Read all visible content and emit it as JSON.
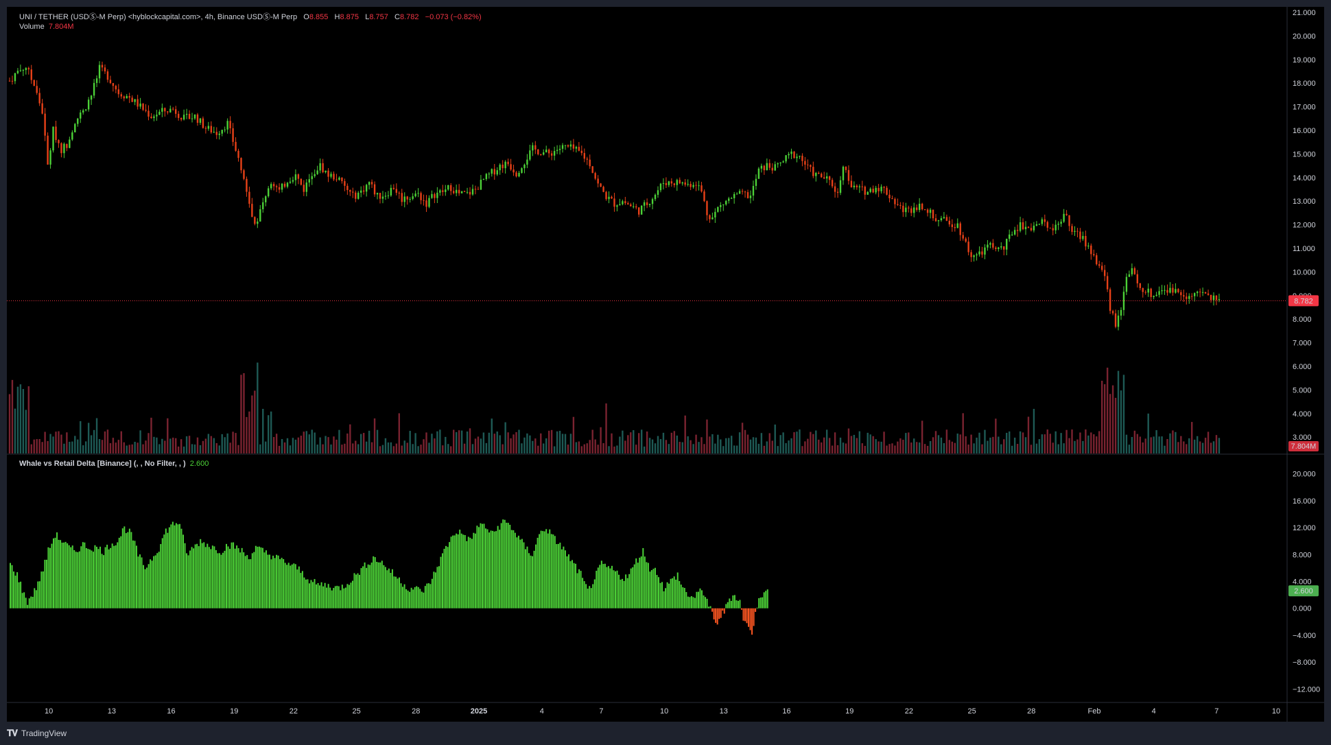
{
  "header": {
    "symbol": "UNI / TETHER (USDⓈ-M Perp) <hyblockcapital.com>, 4h, Binance USDⓈ-M Perp",
    "o_label": "O",
    "o_value": "8.855",
    "h_label": "H",
    "h_value": "8.875",
    "l_label": "L",
    "l_value": "8.757",
    "c_label": "C",
    "c_value": "8.782",
    "change": "−0.073 (−0.82%)",
    "volume_label": "Volume",
    "volume_value": "7.804M"
  },
  "indicator": {
    "title": "Whale vs Retail Delta [Binance] (, , No Filter, , )",
    "value": "2.600"
  },
  "footer": {
    "brand": "TradingView"
  },
  "colors": {
    "up": "#22ab94",
    "down": "#f23645",
    "candle_up": "#4cd137",
    "candle_down": "#e84118",
    "vol_up": "#1e5a55",
    "vol_down": "#7a2330",
    "delta_pos": "#4cd137",
    "delta_neg": "#ff5722",
    "price_tag": "#f23645",
    "delta_tag": "#4caf50"
  },
  "chart_data": [
    {
      "type": "candlestick",
      "title": "",
      "price_axis_ticks": [
        "21.000",
        "20.000",
        "19.000",
        "18.000",
        "17.000",
        "16.000",
        "15.000",
        "14.000",
        "13.000",
        "12.000",
        "11.000",
        "10.000",
        "9.000",
        "8.000",
        "7.000",
        "6.000",
        "5.000",
        "4.000",
        "3.000"
      ],
      "ylim": [
        2.5,
        21.0
      ],
      "x_ticks": [
        "10",
        "13",
        "16",
        "19",
        "22",
        "25",
        "28",
        "2025",
        "4",
        "7",
        "10",
        "13",
        "16",
        "19",
        "22",
        "25",
        "28",
        "Feb",
        "4",
        "7",
        "10"
      ],
      "last_price": "8.782",
      "price_path": [
        [
          0,
          18.1
        ],
        [
          3,
          18.5
        ],
        [
          6,
          18.7
        ],
        [
          9,
          17.9
        ],
        [
          12,
          16.8
        ],
        [
          14,
          14.5
        ],
        [
          16,
          16.0
        ],
        [
          19,
          15.2
        ],
        [
          21,
          15.4
        ],
        [
          24,
          16.4
        ],
        [
          27,
          16.8
        ],
        [
          30,
          17.5
        ],
        [
          33,
          18.6
        ],
        [
          36,
          18.3
        ],
        [
          40,
          17.6
        ],
        [
          44,
          17.4
        ],
        [
          48,
          17.0
        ],
        [
          52,
          16.6
        ],
        [
          56,
          16.8
        ],
        [
          60,
          16.9
        ],
        [
          64,
          16.5
        ],
        [
          68,
          16.6
        ],
        [
          72,
          16.1
        ],
        [
          76,
          15.9
        ],
        [
          80,
          16.3
        ],
        [
          84,
          14.8
        ],
        [
          86,
          13.9
        ],
        [
          88,
          12.8
        ],
        [
          90,
          12.0
        ],
        [
          92,
          12.6
        ],
        [
          94,
          13.3
        ],
        [
          96,
          13.9
        ],
        [
          99,
          13.4
        ],
        [
          102,
          13.9
        ],
        [
          105,
          14.1
        ],
        [
          108,
          13.5
        ],
        [
          111,
          14.2
        ],
        [
          114,
          14.5
        ],
        [
          117,
          14.1
        ],
        [
          120,
          14.0
        ],
        [
          123,
          13.6
        ],
        [
          126,
          13.2
        ],
        [
          129,
          13.4
        ],
        [
          132,
          13.8
        ],
        [
          135,
          13.2
        ],
        [
          138,
          13.3
        ],
        [
          141,
          13.6
        ],
        [
          144,
          13.1
        ],
        [
          147,
          13.2
        ],
        [
          150,
          13.3
        ],
        [
          153,
          12.9
        ],
        [
          156,
          13.3
        ],
        [
          159,
          13.4
        ],
        [
          162,
          13.6
        ],
        [
          165,
          13.3
        ],
        [
          168,
          13.3
        ],
        [
          171,
          13.5
        ],
        [
          174,
          13.9
        ],
        [
          177,
          14.2
        ],
        [
          180,
          14.5
        ],
        [
          183,
          14.6
        ],
        [
          186,
          14.2
        ],
        [
          189,
          14.7
        ],
        [
          192,
          15.2
        ],
        [
          195,
          15.1
        ],
        [
          198,
          15.0
        ],
        [
          201,
          15.2
        ],
        [
          204,
          15.3
        ],
        [
          207,
          15.2
        ],
        [
          210,
          15.0
        ],
        [
          213,
          14.6
        ],
        [
          216,
          13.7
        ],
        [
          219,
          13.2
        ],
        [
          222,
          12.9
        ],
        [
          225,
          13.0
        ],
        [
          228,
          12.8
        ],
        [
          231,
          12.6
        ],
        [
          234,
          12.9
        ],
        [
          237,
          13.3
        ],
        [
          240,
          13.8
        ],
        [
          243,
          13.8
        ],
        [
          246,
          13.8
        ],
        [
          249,
          13.7
        ],
        [
          252,
          13.8
        ],
        [
          254,
          13.4
        ],
        [
          256,
          12.5
        ],
        [
          258,
          12.3
        ],
        [
          260,
          12.7
        ],
        [
          263,
          13.0
        ],
        [
          266,
          13.2
        ],
        [
          269,
          13.3
        ],
        [
          272,
          13.2
        ],
        [
          275,
          14.3
        ],
        [
          278,
          14.5
        ],
        [
          281,
          14.4
        ],
        [
          284,
          14.7
        ],
        [
          287,
          15.0
        ],
        [
          290,
          14.9
        ],
        [
          293,
          14.4
        ],
        [
          296,
          14.1
        ],
        [
          299,
          14.0
        ],
        [
          302,
          13.7
        ],
        [
          304,
          13.3
        ],
        [
          306,
          14.6
        ],
        [
          309,
          13.6
        ],
        [
          312,
          13.5
        ],
        [
          315,
          13.4
        ],
        [
          318,
          13.6
        ],
        [
          321,
          13.5
        ],
        [
          324,
          13.1
        ],
        [
          327,
          12.7
        ],
        [
          330,
          12.6
        ],
        [
          333,
          12.8
        ],
        [
          336,
          12.8
        ],
        [
          339,
          12.3
        ],
        [
          342,
          12.2
        ],
        [
          345,
          12.1
        ],
        [
          348,
          12.0
        ],
        [
          351,
          11.2
        ],
        [
          353,
          10.7
        ],
        [
          356,
          10.7
        ],
        [
          359,
          11.1
        ],
        [
          362,
          11.0
        ],
        [
          365,
          11.0
        ],
        [
          368,
          11.7
        ],
        [
          371,
          12.0
        ],
        [
          374,
          11.9
        ],
        [
          377,
          12.0
        ],
        [
          380,
          12.1
        ],
        [
          383,
          11.9
        ],
        [
          386,
          12.2
        ],
        [
          388,
          12.4
        ],
        [
          390,
          11.7
        ],
        [
          393,
          11.5
        ],
        [
          396,
          11.1
        ],
        [
          399,
          10.4
        ],
        [
          402,
          9.9
        ],
        [
          404,
          8.5
        ],
        [
          406,
          7.8
        ],
        [
          408,
          8.5
        ],
        [
          410,
          9.8
        ],
        [
          412,
          10.0
        ],
        [
          414,
          9.5
        ],
        [
          417,
          9.2
        ],
        [
          420,
          9.0
        ],
        [
          423,
          9.3
        ],
        [
          426,
          9.2
        ],
        [
          429,
          9.2
        ],
        [
          432,
          9.0
        ],
        [
          435,
          9.0
        ],
        [
          438,
          9.1
        ],
        [
          441,
          8.9
        ],
        [
          444,
          8.78
        ]
      ]
    },
    {
      "type": "bar",
      "name": "Volume",
      "last_value": "7.804M",
      "note": "volume histogram beneath candles"
    },
    {
      "type": "bar",
      "name": "Whale vs Retail Delta",
      "y_ticks": [
        "20.000",
        "16.000",
        "12.000",
        "8.000",
        "4.000",
        "0.000",
        "−4.000",
        "−8.000",
        "−12.000"
      ],
      "ylim": [
        -14,
        21
      ],
      "last_value": "2.600",
      "values_path": [
        [
          0,
          6.5
        ],
        [
          4,
          5.0
        ],
        [
          8,
          2.0
        ],
        [
          10,
          1.0
        ],
        [
          14,
          2.5
        ],
        [
          18,
          5.0
        ],
        [
          22,
          8.5
        ],
        [
          26,
          11.0
        ],
        [
          30,
          10.0
        ],
        [
          34,
          9.0
        ],
        [
          38,
          8.5
        ],
        [
          42,
          9.5
        ],
        [
          46,
          9.0
        ],
        [
          50,
          9.0
        ],
        [
          54,
          8.5
        ],
        [
          58,
          9.5
        ],
        [
          62,
          10.0
        ],
        [
          66,
          12.0
        ],
        [
          70,
          11.0
        ],
        [
          74,
          8.0
        ],
        [
          78,
          6.0
        ],
        [
          82,
          7.5
        ],
        [
          86,
          9.0
        ],
        [
          90,
          11.5
        ],
        [
          94,
          12.5
        ],
        [
          98,
          12.8
        ],
        [
          102,
          8.0
        ],
        [
          106,
          9.0
        ],
        [
          110,
          10.0
        ],
        [
          114,
          9.5
        ],
        [
          118,
          9.0
        ],
        [
          122,
          8.5
        ],
        [
          126,
          9.5
        ],
        [
          130,
          9.2
        ],
        [
          134,
          8.5
        ],
        [
          138,
          7.5
        ],
        [
          142,
          9.0
        ],
        [
          146,
          8.5
        ],
        [
          150,
          8.0
        ],
        [
          154,
          7.5
        ],
        [
          158,
          7.0
        ],
        [
          162,
          6.5
        ],
        [
          166,
          6.0
        ],
        [
          170,
          5.0
        ],
        [
          174,
          4.0
        ],
        [
          178,
          3.5
        ],
        [
          182,
          3.5
        ],
        [
          186,
          3.2
        ],
        [
          190,
          3.0
        ],
        [
          194,
          3.5
        ],
        [
          198,
          4.5
        ],
        [
          202,
          5.5
        ],
        [
          206,
          6.5
        ],
        [
          210,
          7.5
        ],
        [
          214,
          7.0
        ],
        [
          218,
          6.0
        ],
        [
          222,
          5.0
        ],
        [
          226,
          4.0
        ],
        [
          230,
          3.0
        ],
        [
          234,
          3.0
        ],
        [
          238,
          2.5
        ],
        [
          242,
          3.5
        ],
        [
          246,
          5.5
        ],
        [
          250,
          8.0
        ],
        [
          254,
          10.0
        ],
        [
          258,
          11.5
        ],
        [
          262,
          11.0
        ],
        [
          266,
          10.0
        ],
        [
          270,
          12.0
        ],
        [
          274,
          12.5
        ],
        [
          278,
          11.0
        ],
        [
          282,
          12.0
        ],
        [
          286,
          13.0
        ],
        [
          290,
          12.0
        ],
        [
          294,
          10.5
        ],
        [
          298,
          9.0
        ],
        [
          302,
          8.0
        ],
        [
          306,
          11.0
        ],
        [
          310,
          12.0
        ],
        [
          314,
          10.5
        ],
        [
          318,
          9.5
        ],
        [
          322,
          8.0
        ],
        [
          326,
          6.5
        ],
        [
          330,
          5.0
        ],
        [
          334,
          2.5
        ],
        [
          338,
          4.5
        ],
        [
          342,
          6.5
        ],
        [
          346,
          6.0
        ],
        [
          350,
          5.5
        ],
        [
          354,
          4.5
        ],
        [
          358,
          5.0
        ],
        [
          362,
          7.0
        ],
        [
          366,
          8.5
        ],
        [
          370,
          6.0
        ],
        [
          374,
          5.5
        ],
        [
          378,
          3.0
        ],
        [
          382,
          4.0
        ],
        [
          386,
          5.0
        ],
        [
          388,
          3.5
        ],
        [
          392,
          2.0
        ],
        [
          396,
          1.5
        ],
        [
          400,
          3.0
        ],
        [
          404,
          0.5
        ],
        [
          406,
          -1.0
        ],
        [
          408,
          -2.5
        ],
        [
          410,
          -1.5
        ],
        [
          413,
          -0.5
        ],
        [
          416,
          1.5
        ],
        [
          419,
          2.0
        ],
        [
          422,
          1.0
        ],
        [
          424,
          -1.5
        ],
        [
          427,
          -3.0
        ],
        [
          429,
          -3.5
        ],
        [
          431,
          -1.0
        ],
        [
          433,
          2.0
        ],
        [
          436,
          2.0
        ],
        [
          438,
          2.6
        ]
      ]
    }
  ]
}
